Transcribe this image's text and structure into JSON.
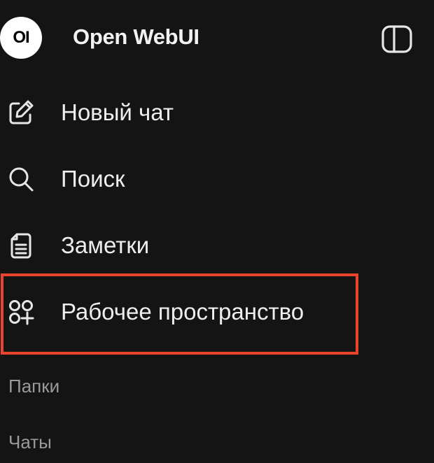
{
  "header": {
    "logo_text": "OI",
    "title": "Open WebUI",
    "toggle_icon": "sidebar-toggle-icon"
  },
  "nav": {
    "items": [
      {
        "label": "Новый чат",
        "icon": "pencil-square-icon"
      },
      {
        "label": "Поиск",
        "icon": "search-icon"
      },
      {
        "label": "Заметки",
        "icon": "note-icon"
      },
      {
        "label": "Рабочее пространство",
        "icon": "workspace-icon"
      }
    ]
  },
  "sections": {
    "folders_label": "Папки",
    "chats_label": "Чаты"
  },
  "colors": {
    "background": "#141414",
    "text": "#eeeeee",
    "muted_text": "#9a9a9a",
    "highlight_border": "#e8452c"
  }
}
